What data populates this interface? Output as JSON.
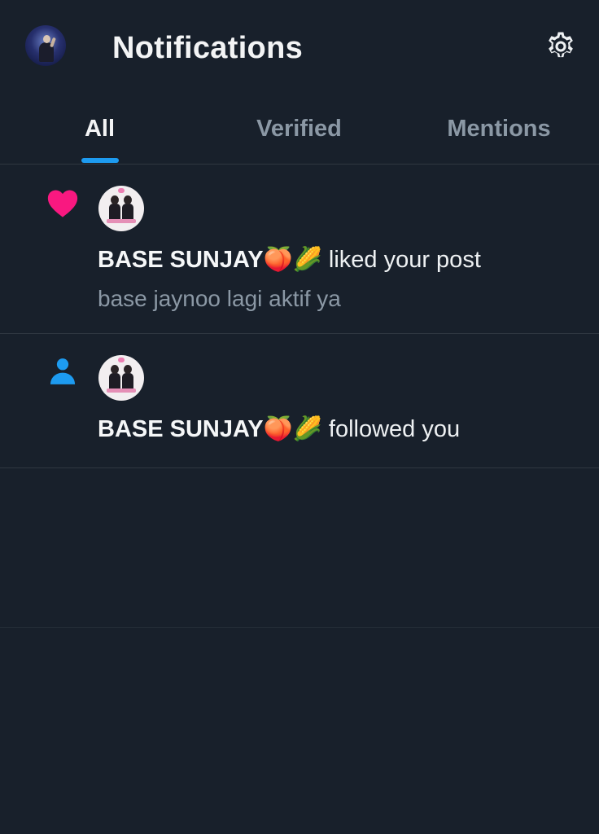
{
  "header": {
    "title": "Notifications",
    "avatar_icon": "profile-avatar",
    "settings_icon": "gear-icon"
  },
  "tabs": [
    {
      "label": "All",
      "active": true
    },
    {
      "label": "Verified",
      "active": false
    },
    {
      "label": "Mentions",
      "active": false
    }
  ],
  "colors": {
    "background": "#18202b",
    "accent": "#1d9bf0",
    "like": "#f91880",
    "muted_text": "#8b98a5",
    "divider": "#2f3740"
  },
  "notifications": [
    {
      "type_icon": "heart-icon",
      "actor": "BASE SUNJAY🍑🌽",
      "action": " liked your post",
      "preview": "base jaynoo lagi aktif ya"
    },
    {
      "type_icon": "person-icon",
      "actor": "BASE SUNJAY🍑🌽",
      "action": " followed you"
    }
  ]
}
